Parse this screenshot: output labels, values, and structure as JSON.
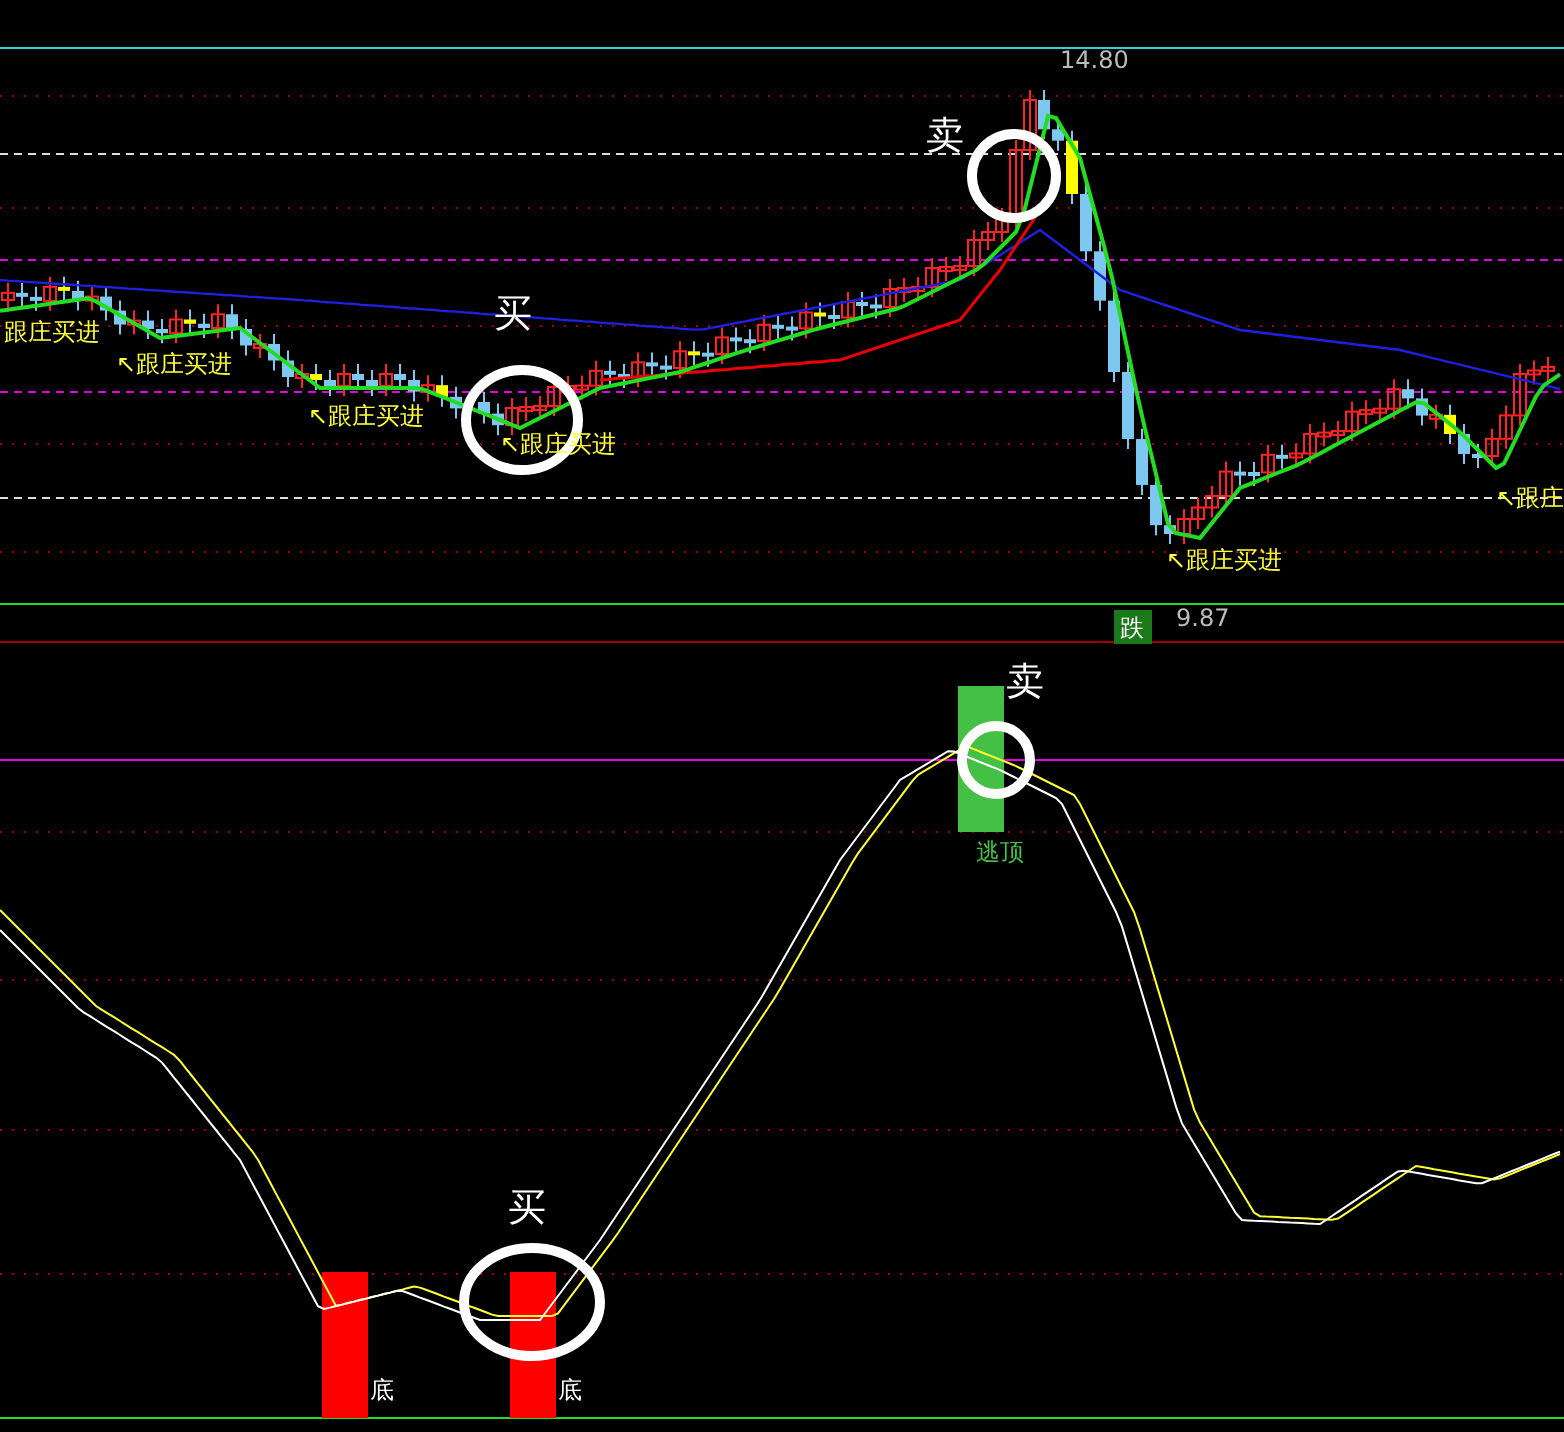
{
  "price_panel": {
    "high_label": "14.80",
    "low_label": "9.87",
    "fall_badge": "跌",
    "signals": [
      {
        "text": "跟庄买进"
      },
      {
        "text": "↖跟庄买进"
      },
      {
        "text": "↖跟庄买进"
      },
      {
        "text": "↖跟庄买进"
      },
      {
        "text": "↖跟庄买进"
      },
      {
        "text": "↖跟庄"
      }
    ],
    "callouts": [
      {
        "text": "卖"
      },
      {
        "text": "买"
      }
    ]
  },
  "indicator_panel": {
    "callouts": [
      {
        "text": "卖"
      },
      {
        "text": "买"
      }
    ],
    "top_label": "逃顶",
    "bottom_labels": [
      {
        "text": "底"
      },
      {
        "text": "底"
      }
    ]
  }
}
